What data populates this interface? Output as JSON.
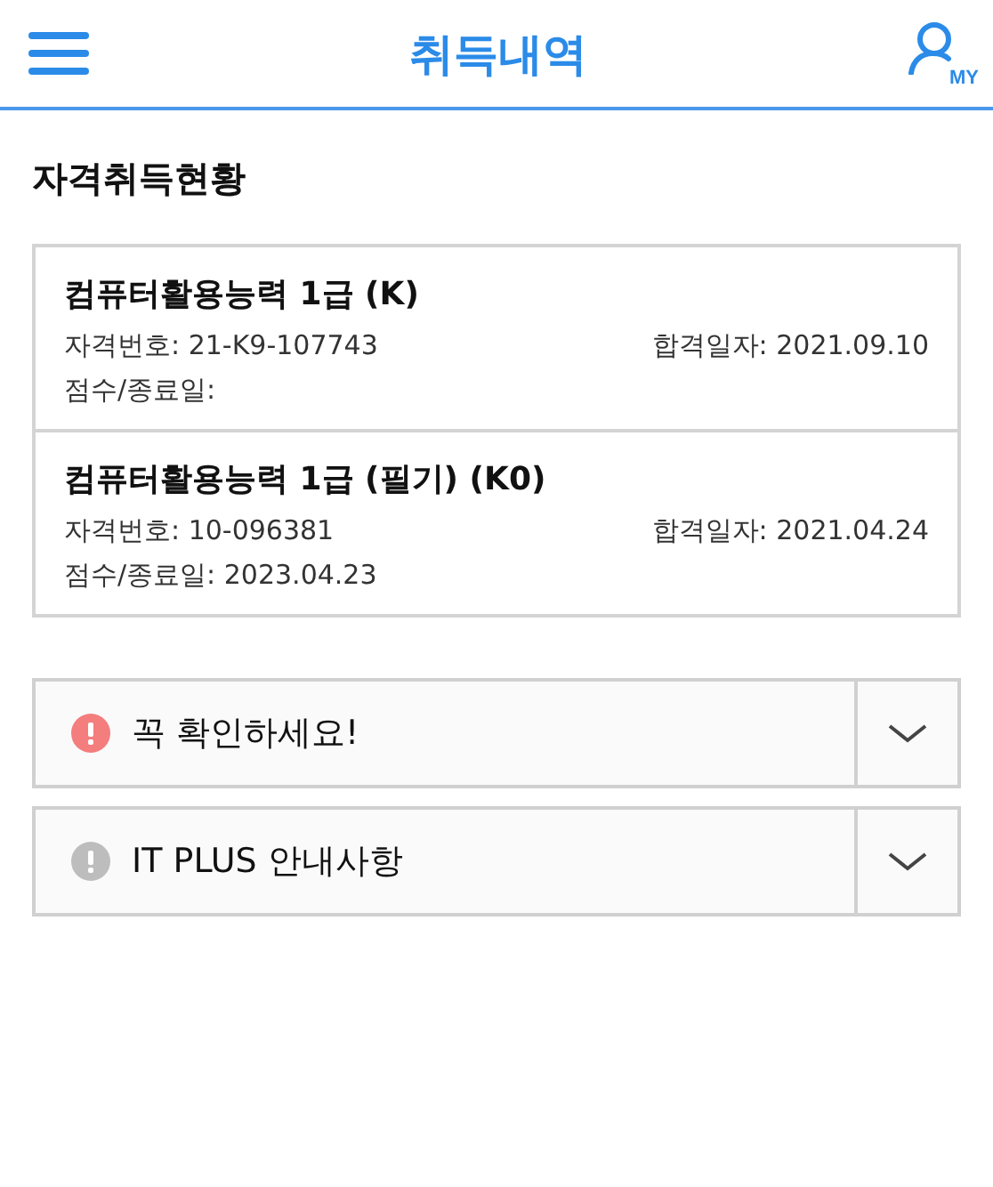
{
  "header": {
    "title": "취득내역",
    "my_label": "MY"
  },
  "section_title": "자격취득현황",
  "records": [
    {
      "name": "컴퓨터활용능력 1급 (K)",
      "number": "자격번호: 21-K9-107743",
      "pass_date": "합격일자: 2021.09.10",
      "score": "점수/종료일:"
    },
    {
      "name": "컴퓨터활용능력 1급 (필기) (K0)",
      "number": "자격번호: 10-096381",
      "pass_date": "합격일자: 2021.04.24",
      "score": "점수/종료일: 2023.04.23"
    }
  ],
  "notices": [
    {
      "label": "꼭 확인하세요!",
      "color": "#f47d7d",
      "expanded": false
    },
    {
      "label": "IT PLUS 안내사항",
      "color": "#bdbdbd",
      "expanded": false
    }
  ]
}
